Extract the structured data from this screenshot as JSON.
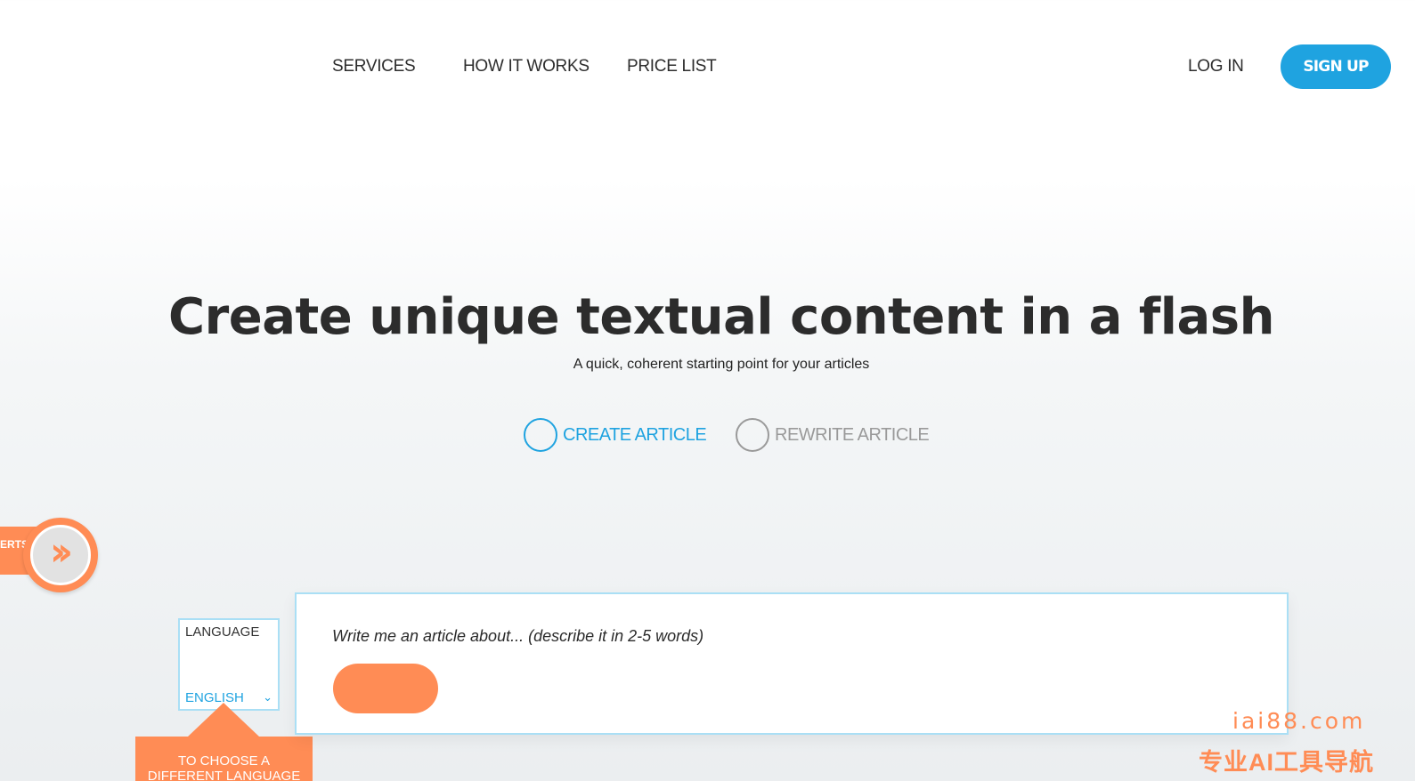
{
  "nav": {
    "services": "SERVICES",
    "how_it_works": "HOW IT WORKS",
    "price_list": "PRICE LIST",
    "login": "LOG IN",
    "signup": "SIGN UP"
  },
  "hero": {
    "title": "Create unique textual content in a flash",
    "subtitle": "A quick, coherent starting point for your articles"
  },
  "modes": {
    "create": "CREATE ARTICLE",
    "rewrite": "REWRITE ARTICLE",
    "selected": "CREATE ARTICLE"
  },
  "side_tab": {
    "text": "ERTS",
    "icon": "double-chevron-right-icon"
  },
  "language": {
    "title": "LANGUAGE",
    "value": "ENGLISH",
    "tooltip_line1": "TO CHOOSE A",
    "tooltip_line2": "DIFFERENT LANGUAGE"
  },
  "article": {
    "placeholder": "Write me an article about... (describe it in 2-5 words)"
  },
  "watermark": {
    "domain": "iai88.com",
    "tagline": "专业AI工具导航"
  },
  "colors": {
    "accent_blue": "#1fa3e0",
    "accent_orange": "#ff8c55",
    "border_light_blue": "#aadff5"
  }
}
